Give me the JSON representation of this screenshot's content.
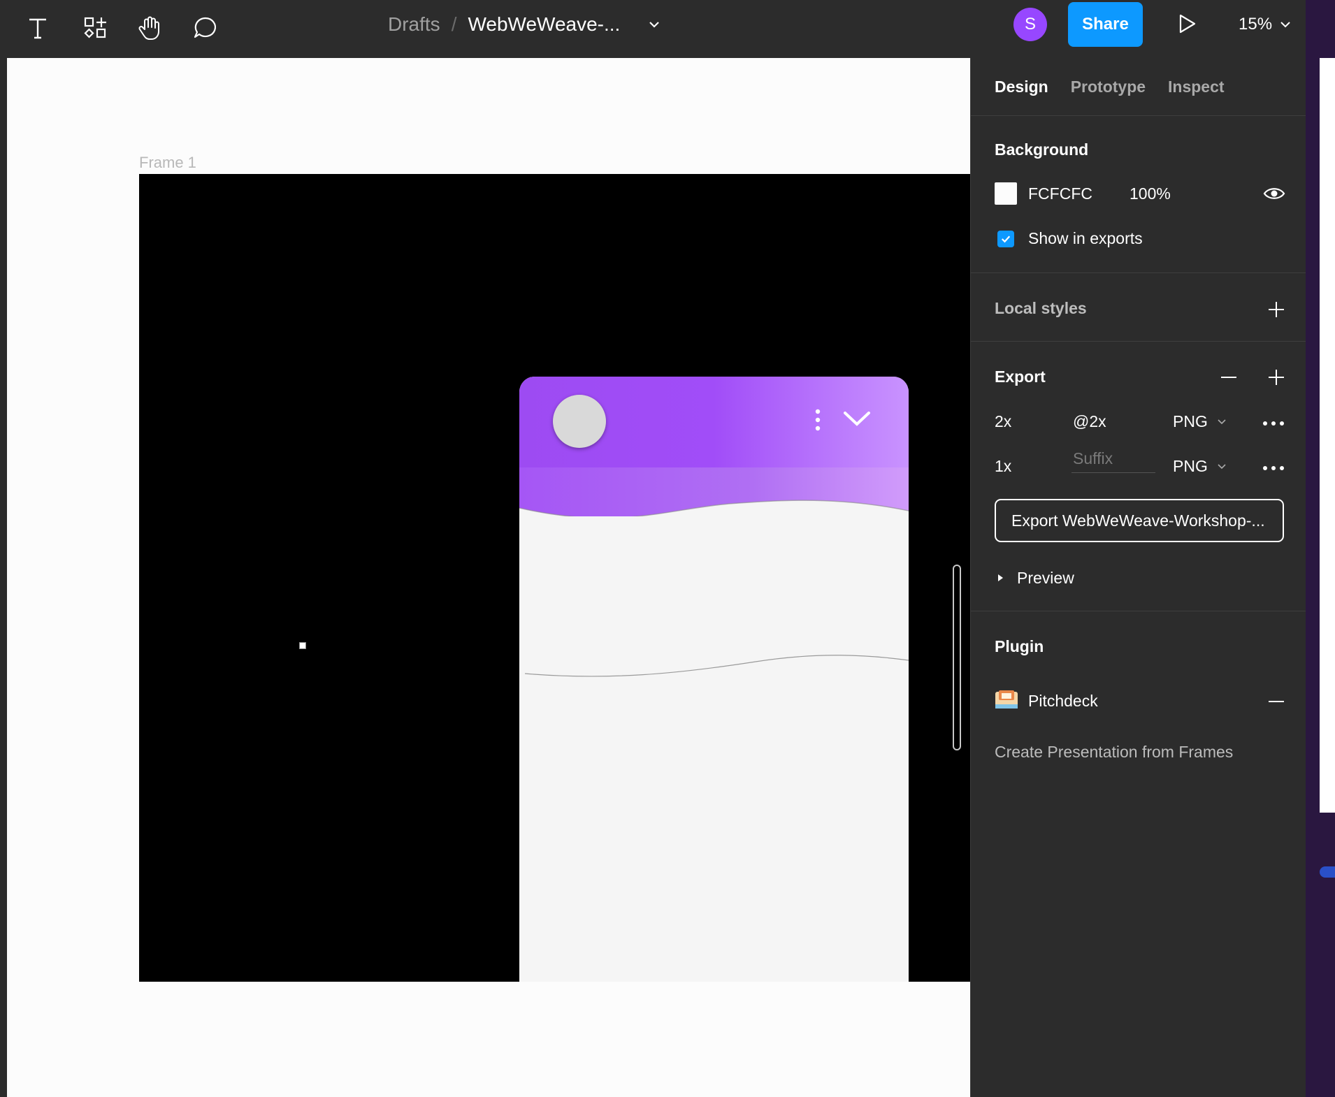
{
  "toolbar": {
    "tools": [
      "text-tool-icon",
      "components-tool-icon",
      "hand-tool-icon",
      "comment-tool-icon"
    ],
    "breadcrumb_root": "Drafts",
    "breadcrumb_sep": "/",
    "file_name": "WebWeWeave-...",
    "avatar_initial": "S",
    "avatar_color": "#9747ff",
    "share_label": "Share",
    "share_color": "#0d99ff",
    "zoom_label": "15%"
  },
  "canvas": {
    "frame_label": "Frame 1",
    "canvas_bg": "#fcfcfc",
    "frame_bg": "#000000",
    "card_gradient": [
      "#9d4bf2",
      "#a14df8",
      "#c993ff"
    ]
  },
  "panel": {
    "tabs": [
      {
        "label": "Design",
        "active": true
      },
      {
        "label": "Prototype",
        "active": false
      },
      {
        "label": "Inspect",
        "active": false
      }
    ],
    "background": {
      "title": "Background",
      "color_hex": "FCFCFC",
      "opacity": "100%",
      "show_in_exports": "Show in exports",
      "show_in_exports_checked": true
    },
    "local_styles": {
      "title": "Local styles"
    },
    "export": {
      "title": "Export",
      "rows": [
        {
          "scale": "2x",
          "suffix": "@2x",
          "format": "PNG"
        },
        {
          "scale": "1x",
          "suffix_placeholder": "Suffix",
          "format": "PNG"
        }
      ],
      "button_label": "Export WebWeWeave-Workshop-...",
      "preview_label": "Preview"
    },
    "plugin": {
      "title": "Plugin",
      "name": "Pitchdeck",
      "description": "Create Presentation from Frames"
    }
  }
}
